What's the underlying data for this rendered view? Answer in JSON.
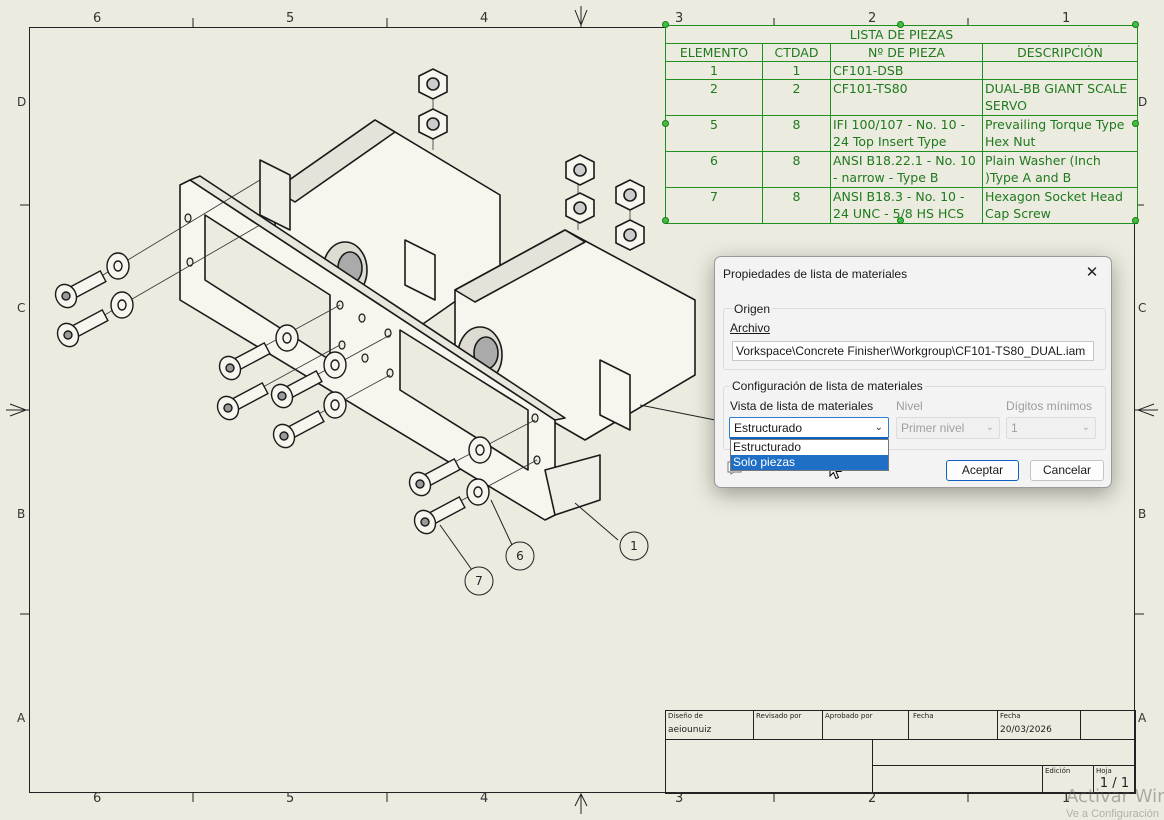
{
  "sheet": {
    "zones_top": [
      "6",
      "5",
      "4",
      "3",
      "2",
      "1"
    ],
    "zones_bottom": [
      "6",
      "5",
      "4",
      "3",
      "2",
      "1"
    ],
    "zones_left": [
      "D",
      "C",
      "B",
      "A"
    ],
    "zones_right": [
      "D",
      "C",
      "B",
      "A"
    ]
  },
  "balloons": [
    "1",
    "6",
    "7"
  ],
  "bom": {
    "title": "LISTA DE PIEZAS",
    "headers": [
      "ELEMENTO",
      "CTDAD",
      "Nº DE PIEZA",
      "DESCRIPCIÓN"
    ],
    "rows": [
      {
        "item": "1",
        "qty": "1",
        "part": "CF101-DSB",
        "desc": ""
      },
      {
        "item": "2",
        "qty": "2",
        "part": "CF101-TS80",
        "desc": "DUAL-BB GIANT SCALE SERVO"
      },
      {
        "item": "5",
        "qty": "8",
        "part": "IFI 100/107 - No. 10 - 24 Top Insert Type",
        "desc": "Prevailing Torque Type Hex Nut"
      },
      {
        "item": "6",
        "qty": "8",
        "part": "ANSI B18.22.1 - No. 10 - narrow - Type B",
        "desc": "Plain Washer (Inch )Type A and B"
      },
      {
        "item": "7",
        "qty": "8",
        "part": "ANSI B18.3 - No. 10 - 24 UNC - 5/8 HS HCS",
        "desc": "Hexagon Socket Head Cap Screw"
      }
    ]
  },
  "title_block": {
    "design_label": "Diseño de",
    "design_value": "aeiounuiz",
    "revised_label": "Revisado por",
    "approved_label": "Aprobado por",
    "date_label1": "Fecha",
    "date_label2": "Fecha",
    "date_value": "20/03/2026",
    "edition_label": "Edición",
    "sheet_label": "Hoja",
    "sheet_value": "1 / 1"
  },
  "dialog": {
    "title": "Propiedades de lista de materiales",
    "close_glyph": "✕",
    "origin_group": "Origen",
    "file_label": "Archivo",
    "file_path": "Vorkspace\\Concrete Finisher\\Workgroup\\CF101-TS80_DUAL.iam",
    "config_group": "Configuración de lista de materiales",
    "view_label": "Vista de lista de materiales",
    "level_label": "Nivel",
    "digits_label": "Dígitos mínimos",
    "view_value": "Estructurado",
    "level_value": "Primer nivel",
    "digits_value": "1",
    "view_options": [
      "Estructurado",
      "Solo piezas"
    ],
    "highlighted_option": "Solo piezas",
    "ok_label": "Aceptar",
    "cancel_label": "Cancelar"
  },
  "watermark": {
    "line1": "Activar Windows",
    "line2": "Ve a Configuración"
  }
}
